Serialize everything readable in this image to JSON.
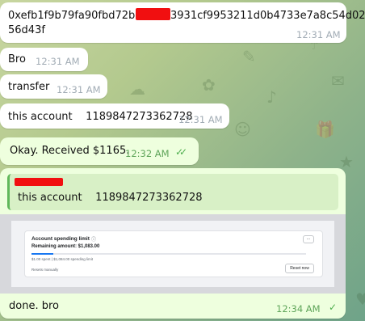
{
  "messages": [
    {
      "line1": "0xefb1f9b79fa90fbd72bdf8",
      "line1_suffix": "3931cf9953211d0b4733e7a8c54d02",
      "line2": "56d43f",
      "time": "12:31 AM"
    },
    {
      "text": "Bro",
      "time": "12:31 AM"
    },
    {
      "text": "transfer",
      "time": "12:31 AM"
    },
    {
      "text": "this account    1189847273362728",
      "time": "12:31 AM"
    },
    {
      "text": "Okay. Received $1165.",
      "time": "12:32 AM",
      "status": "read"
    },
    {
      "reply": {
        "text": "this account    1189847273362728"
      },
      "screenshot": {
        "title": "Account spending limit",
        "remaining": "Remaining amount: $1,083.00",
        "progress_fraction": 0.08,
        "detail": "$1.00 spent | $1,084.00 spending limit",
        "reset_note": "Resets manually",
        "menu_button": "···",
        "reset_button": "Reset now"
      },
      "text": "done. bro",
      "time": "12:34 AM",
      "status": "delivered"
    }
  ],
  "colors": {
    "incoming_bubble": "#ffffff",
    "outgoing_bubble": "#eeffde",
    "redaction": "#f10f10",
    "check_mark": "#4fae4e"
  }
}
